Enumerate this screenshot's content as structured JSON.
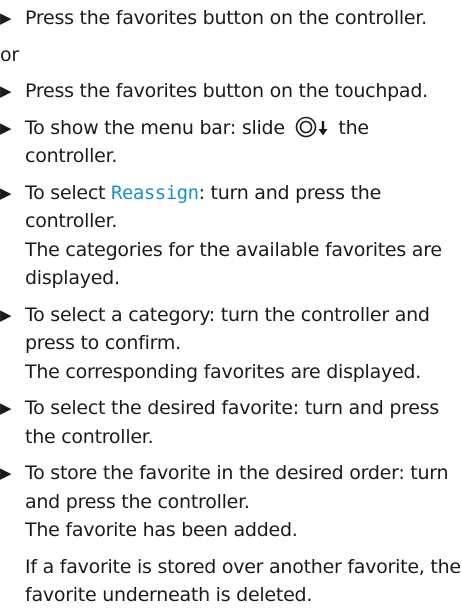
{
  "instructions": {
    "step1": "Press the favorites button on the controller.",
    "or_label": "or",
    "step2": "Press the favorites button on the touchpad.",
    "step3_before": "To show the menu bar: slide ",
    "step3_icon": "controller-slide-down-icon",
    "step3_after": " the controller.",
    "step4_before": "To select ",
    "step4_menu_item": "Reassign",
    "step4_after": ": turn and press the controller.",
    "step4_result": "The categories for the available favorites are displayed.",
    "step5": "To select a category: turn the controller and press to confirm.",
    "step5_result": "The corresponding favorites are displayed.",
    "step6": "To select the desired favorite: turn and press the controller.",
    "step7": "To store the favorite in the desired order: turn and press the controller.",
    "step7_result": "The favorite has been added.",
    "note": "If a favorite is stored over another favorite, the favorite underneath is deleted."
  },
  "colors": {
    "menu_item": "#1a8fd0",
    "text": "#1a1a1a"
  }
}
